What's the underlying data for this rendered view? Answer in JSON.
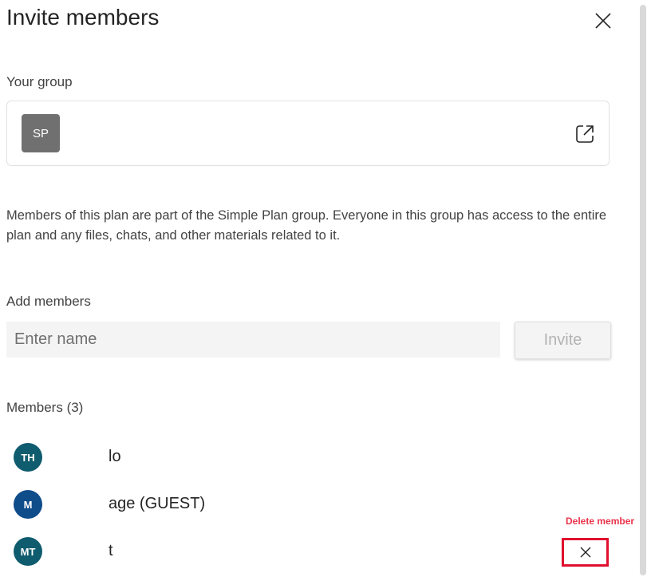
{
  "dialog": {
    "title": "Invite members",
    "close_icon": "close-icon"
  },
  "group": {
    "label": "Your group",
    "avatar_initials": "SP",
    "avatar_color": "#707070",
    "open_icon": "open-in-new-window-icon"
  },
  "description": "Members of this plan are part of the Simple Plan group. Everyone in this group has access to the entire plan and any files, chats, and other materials related to it.",
  "add_members": {
    "label": "Add members",
    "input_placeholder": "Enter name",
    "input_value": "",
    "invite_label": "Invite"
  },
  "members": {
    "header": "Members (3)",
    "items": [
      {
        "initials": "TH",
        "avatar_color": "#0f5c6e",
        "name": "lo"
      },
      {
        "initials": "M",
        "avatar_color": "#0f4c8a",
        "name": "age (GUEST)"
      },
      {
        "initials": "MT",
        "avatar_color": "#0f5c6e",
        "name": "t"
      }
    ]
  },
  "tooltip": {
    "text": "Delete member",
    "color": "#e8344b"
  },
  "highlight_color": "#e0102e"
}
